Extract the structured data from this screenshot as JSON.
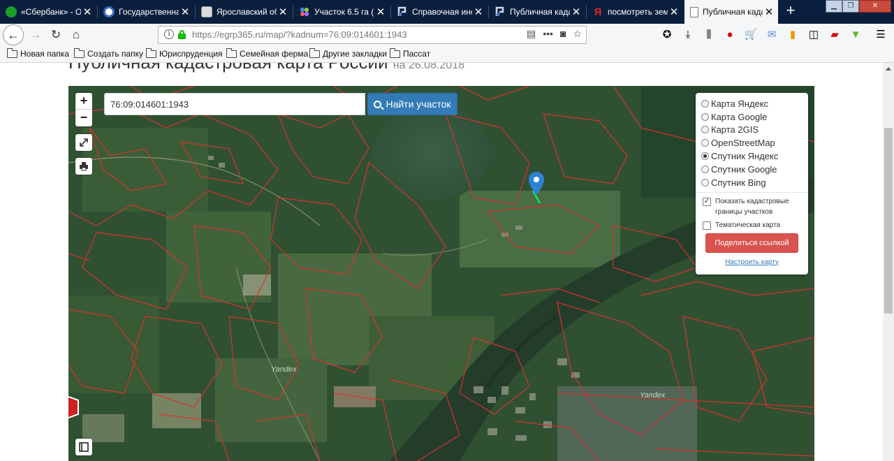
{
  "browser": {
    "tabs": [
      {
        "title": "«Сбербанк» - О",
        "icon": "sberbank-icon",
        "fav_color": "#1a9f29"
      },
      {
        "title": "Государственна",
        "icon": "gosuslugi-icon",
        "fav_color": "#3b6ec4"
      },
      {
        "title": "Ярославский об",
        "icon": "page-icon",
        "fav_color": "#dddddd"
      },
      {
        "title": "Участок 6.5 га (",
        "icon": "avito-icon",
        "fav_color": "#3f8ae0"
      },
      {
        "title": "Справочная инс",
        "icon": "rosreestr-icon",
        "fav_color": "#4a78c2"
      },
      {
        "title": "Публичная када",
        "icon": "rosreestr-icon",
        "fav_color": "#4a78c2"
      },
      {
        "title": "посмотреть зем",
        "icon": "yandex-icon",
        "fav_color": "#e52620"
      },
      {
        "title": "Публичная када",
        "icon": "document-icon",
        "fav_color": "#ffffff",
        "active": true
      }
    ],
    "url": {
      "host": "https://egrp365.ru",
      "path": "/map/?kadnum=76:09:014601:1943"
    },
    "bookmarks": [
      "Новая папка",
      "Создать папку",
      "Юриспруденция",
      "Семейная ферма",
      "Другие закладки",
      "Пассат"
    ]
  },
  "page": {
    "title": "Публичная кадастровая карта России",
    "date": "на 26.08.2018"
  },
  "map": {
    "search_value": "76:09:014601:1943",
    "search_button": "Найти участок",
    "zoom_in": "+",
    "zoom_out": "−",
    "layers": [
      {
        "label": "Карта Яндекс",
        "selected": false
      },
      {
        "label": "Карта Google",
        "selected": false
      },
      {
        "label": "Карта 2GIS",
        "selected": false
      },
      {
        "label": "OpenStreetMap",
        "selected": false
      },
      {
        "label": "Спутник Яндекс",
        "selected": true
      },
      {
        "label": "Спутник Google",
        "selected": false
      },
      {
        "label": "Спутник Bing",
        "selected": false
      }
    ],
    "options": [
      {
        "label": "Показать кадастровые границы участков",
        "checked": true
      },
      {
        "label": "Тематическая карта",
        "checked": false
      }
    ],
    "share_button": "Поделиться ссылкой",
    "configure_link": "Настроить карту",
    "watermark": "Yandex",
    "colors": {
      "boundary": "#e0302e",
      "accent_blue": "#337ab7",
      "share_red": "#d9534f",
      "marker_blue": "#2d82d6",
      "highlight_green": "#1fd65a"
    }
  }
}
